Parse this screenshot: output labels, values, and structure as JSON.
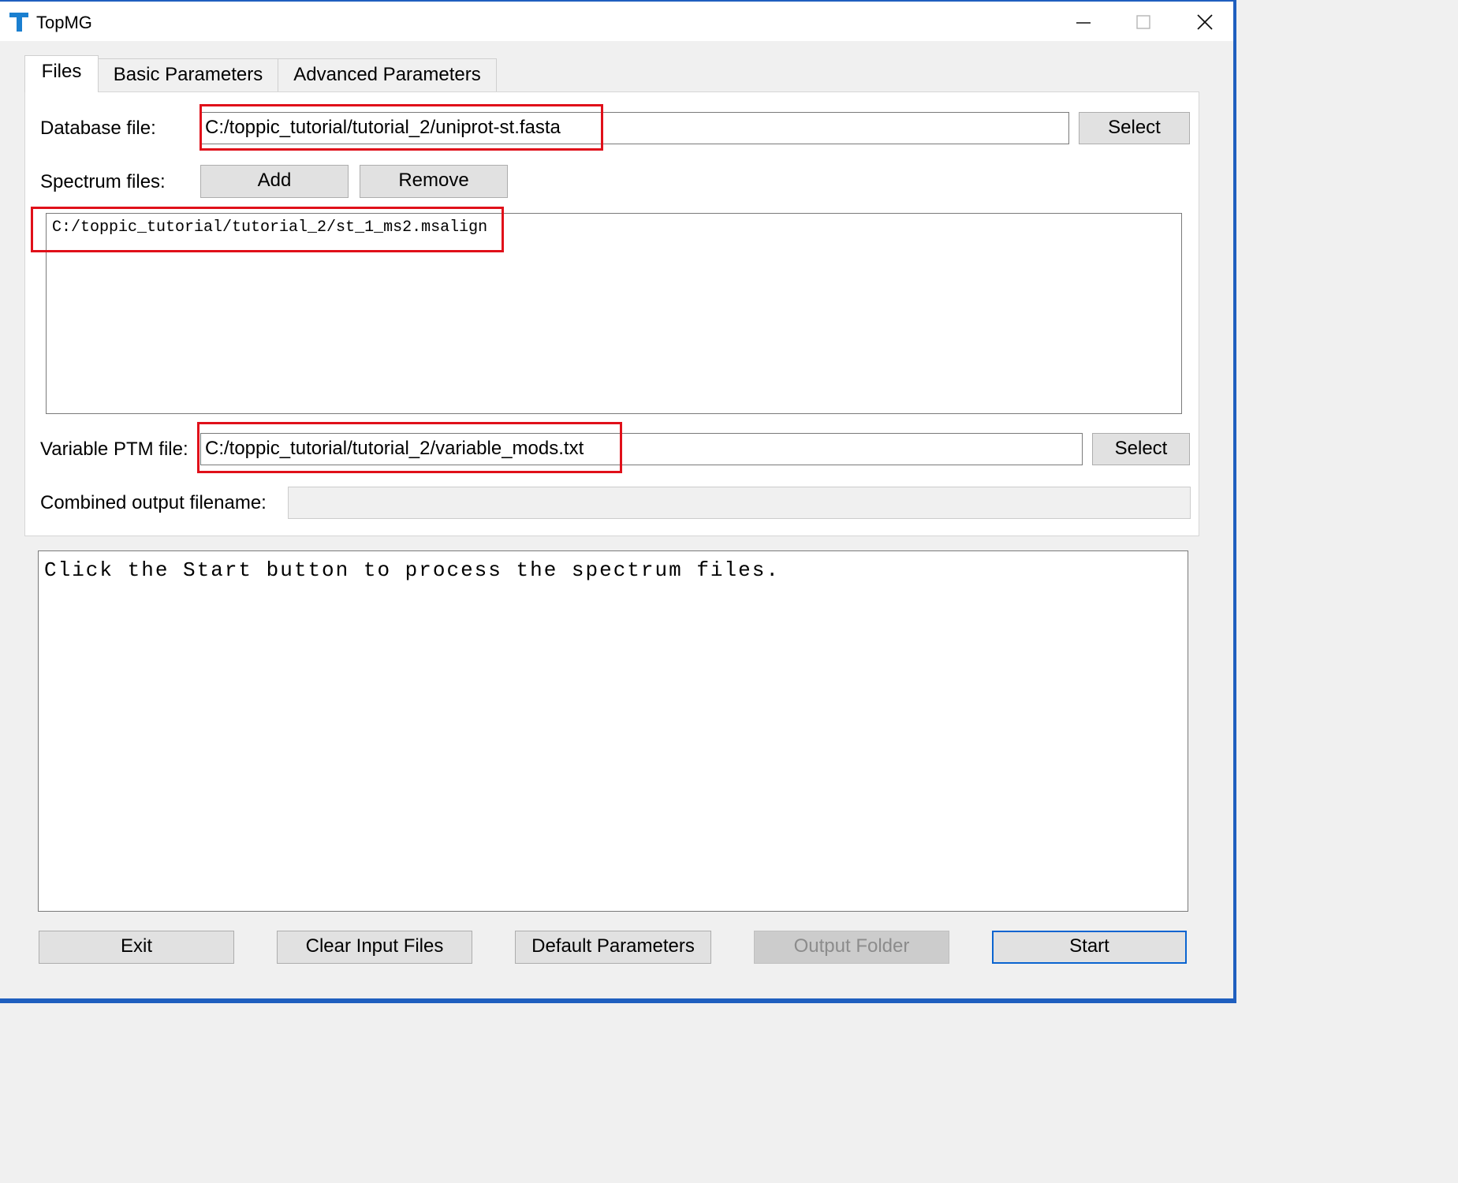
{
  "window": {
    "title": "TopMG",
    "icon_glyph": "T",
    "minimize_glyph": "—",
    "maximize_glyph": "☐",
    "close_glyph": "✕",
    "accent_color": "#1f5fbf"
  },
  "tabs": [
    {
      "label": "Files",
      "active": true
    },
    {
      "label": "Basic Parameters",
      "active": false
    },
    {
      "label": "Advanced Parameters",
      "active": false
    }
  ],
  "files": {
    "database_label": "Database file:",
    "database_value": "C:/toppic_tutorial/tutorial_2/uniprot-st.fasta",
    "database_select": "Select",
    "spectrum_label": "Spectrum files:",
    "add_label": "Add",
    "remove_label": "Remove",
    "spectrum_files": [
      "C:/toppic_tutorial/tutorial_2/st_1_ms2.msalign"
    ],
    "ptm_label": "Variable PTM file:",
    "ptm_value": "C:/toppic_tutorial/tutorial_2/variable_mods.txt",
    "ptm_select": "Select",
    "combined_label": "Combined output filename:",
    "combined_value": ""
  },
  "log": {
    "text": "Click the Start button to process the spectrum files."
  },
  "footer": {
    "exit": "Exit",
    "clear": "Clear Input Files",
    "defaults": "Default Parameters",
    "output_folder": "Output Folder",
    "start": "Start"
  },
  "highlight_color": "#e0101a"
}
